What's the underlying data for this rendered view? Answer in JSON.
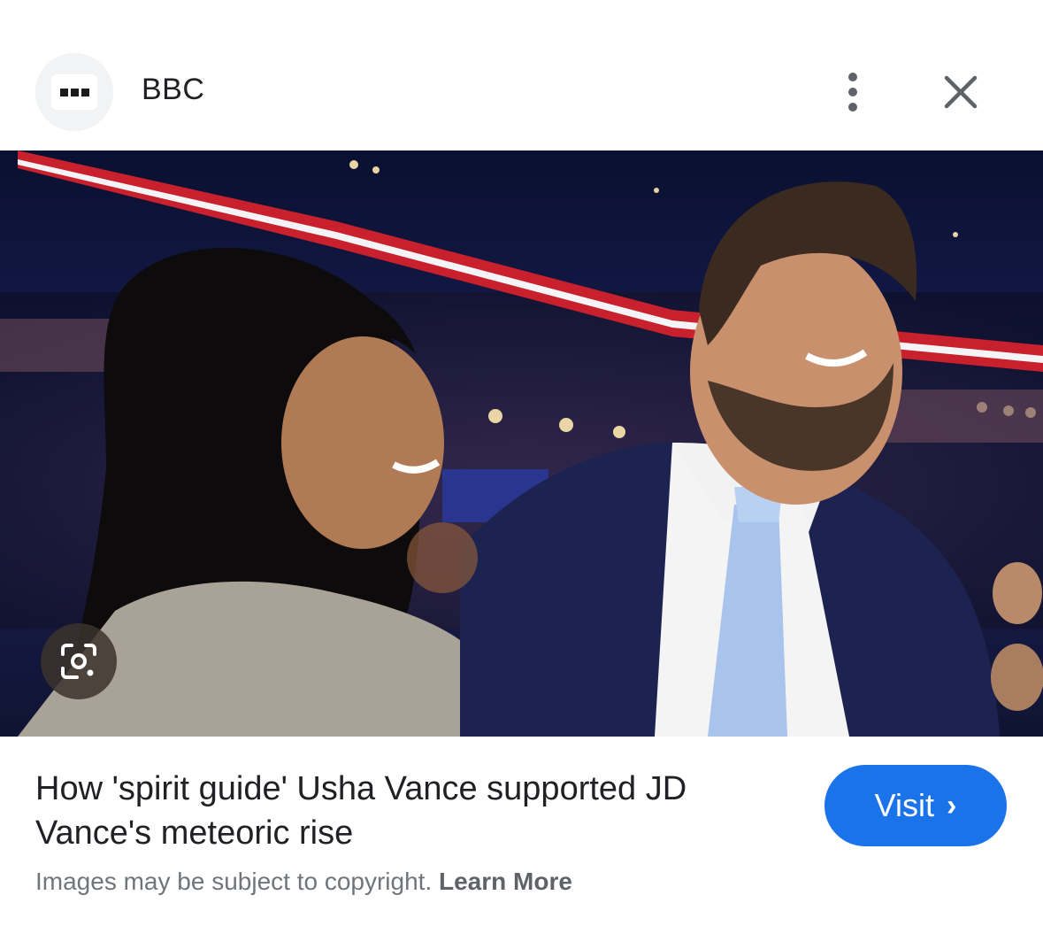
{
  "header": {
    "source": "BBC",
    "favicon_icon": "bbc-logo-icon",
    "more_icon": "more-vert-icon",
    "close_icon": "close-icon"
  },
  "image": {
    "lens_icon": "google-lens-icon"
  },
  "caption": {
    "title": "How 'spirit guide' Usha Vance supported JD Vance's meteoric rise"
  },
  "visit_button": {
    "label": "Visit",
    "chevron": "›",
    "color": "#1a73e8"
  },
  "footer": {
    "notice": "Images may be subject to copyright.",
    "learn_more": "Learn More"
  }
}
